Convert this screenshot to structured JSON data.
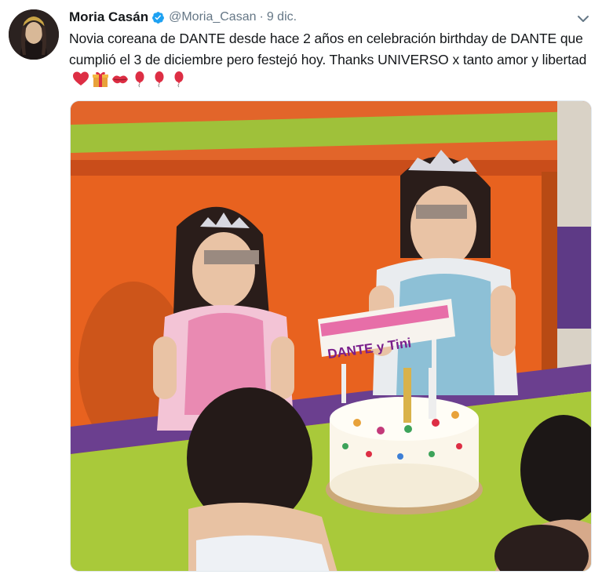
{
  "tweet": {
    "author_name": "Moria Casán",
    "handle": "@Moria_Casan",
    "separator": "·",
    "date": "9 dic.",
    "text": "Novia coreana de DANTE desde hace 2 años en celebración birthday de DANTE que cumplió el 3 de diciembre pero festejó hoy. Thanks UNIVERSO x tanto amor y libertad",
    "emojis": [
      "red-heart-icon",
      "gift-icon",
      "kiss-mark-icon",
      "red-balloon-icon",
      "red-balloon-icon",
      "red-balloon-icon"
    ]
  },
  "photo": {
    "sign_text": "DANTE y Tini",
    "cake_candles": 2
  },
  "colors": {
    "name": "#14171a",
    "secondary": "#657786",
    "verified": "#1da1f2",
    "wall_orange": "#e8621f",
    "table_green": "#a9c93a",
    "table_purple": "#6b3f8f"
  }
}
